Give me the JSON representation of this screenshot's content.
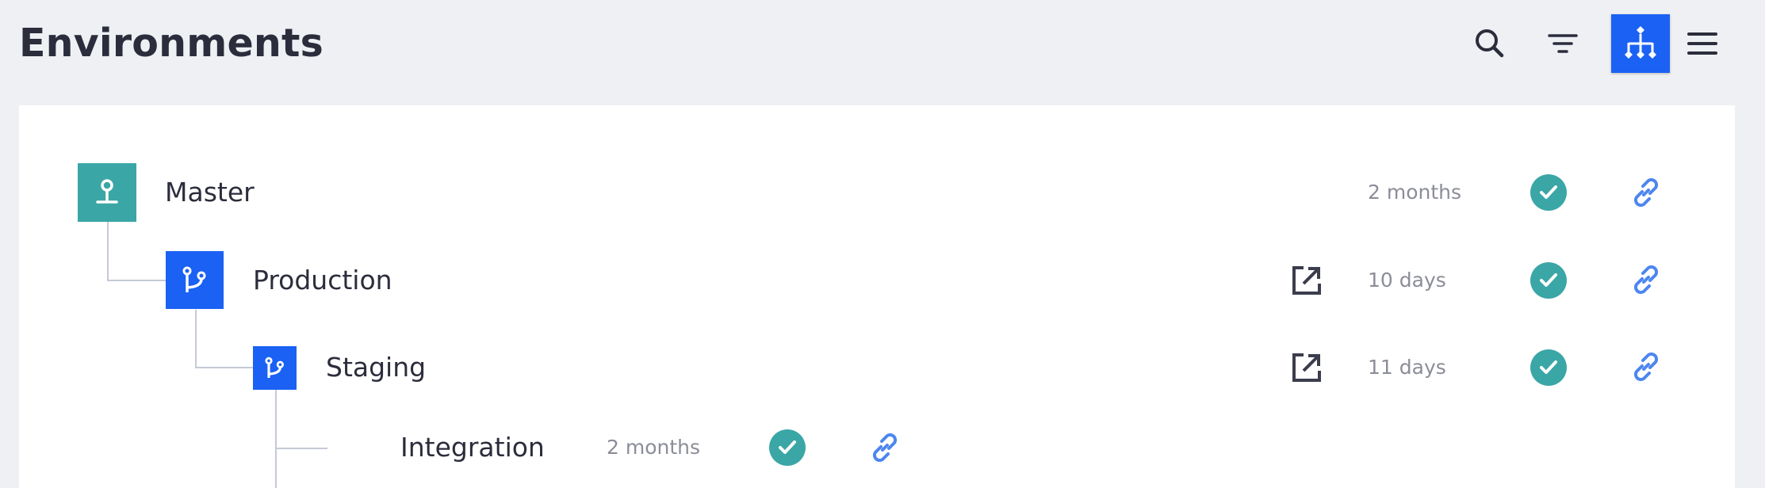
{
  "page": {
    "title": "Environments"
  },
  "toolbar": {
    "buttons": [
      {
        "name": "search",
        "icon": "search-icon"
      },
      {
        "name": "filter",
        "icon": "filter-icon"
      },
      {
        "name": "tree-view",
        "icon": "sitemap-icon",
        "active": true
      },
      {
        "name": "list-view",
        "icon": "menu-icon"
      }
    ]
  },
  "colors": {
    "accent": "#1a61f4",
    "teal": "#3ba6a6",
    "link": "#4d86f0",
    "connector": "#c5c9d6",
    "muted_text": "#8b8d98"
  },
  "environments": [
    {
      "name": "Master",
      "age": "2 months",
      "status": "success",
      "icon": "pin-icon",
      "type": "master",
      "has_open_link": false
    },
    {
      "name": "Production",
      "age": "10 days",
      "status": "success",
      "icon": "branch-icon",
      "type": "branch",
      "has_open_link": true
    },
    {
      "name": "Staging",
      "age": "11 days",
      "status": "success",
      "icon": "branch-icon",
      "type": "branch",
      "has_open_link": true
    },
    {
      "name": "Integration",
      "age": "2 months",
      "status": "success",
      "icon": null,
      "type": "inactive",
      "has_open_link": false
    }
  ]
}
